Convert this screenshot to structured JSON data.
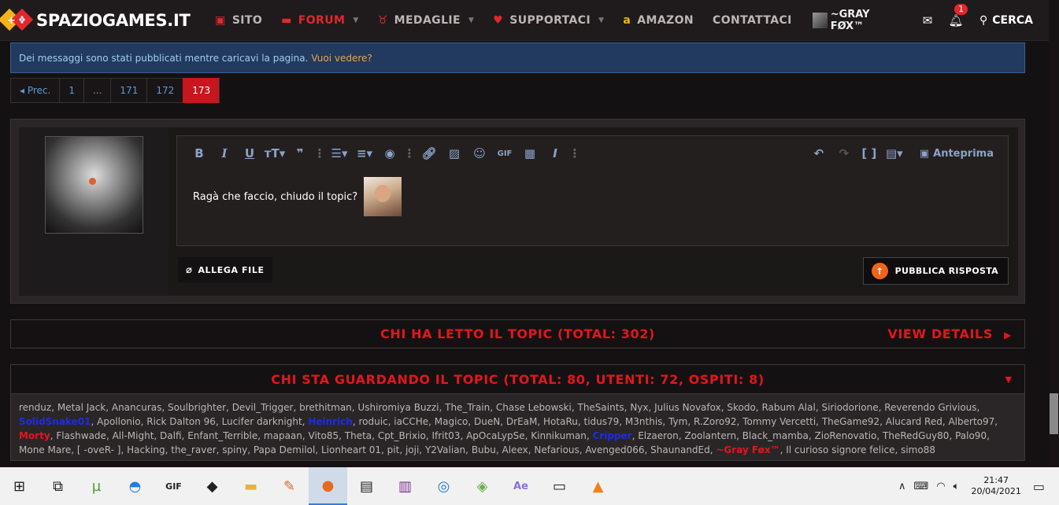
{
  "nav": {
    "logo": "SPAZIOGAMES.IT",
    "items": [
      {
        "label": "SITO",
        "icon": "gamepad-icon",
        "caret": false,
        "active": false
      },
      {
        "label": "FORUM",
        "icon": "chat-icon",
        "caret": true,
        "active": true
      },
      {
        "label": "MEDAGLIE",
        "icon": "medal-icon",
        "caret": true,
        "active": false
      },
      {
        "label": "SUPPORTACI",
        "icon": "heart-icon",
        "caret": true,
        "active": false
      },
      {
        "label": "AMAZON",
        "icon": "amazon-icon",
        "caret": false,
        "active": false
      },
      {
        "label": "CONTATTACI",
        "icon": "",
        "caret": false,
        "active": false
      }
    ],
    "user": "~GRAY FØX™",
    "notification_count": "1",
    "search": "CERCA"
  },
  "notice": {
    "text": "Dei messaggi sono stati pubblicati mentre caricavi la pagina.",
    "link": "Vuoi vedere?"
  },
  "pager": {
    "prev": "◂ Prec.",
    "pages": [
      "1",
      "...",
      "171",
      "172",
      "173"
    ],
    "current": "173"
  },
  "editor": {
    "content": "Ragà che faccio, chiudo il topic?",
    "preview": "Anteprima",
    "attach": "ALLEGA FILE",
    "publish": "PUBBLICA RISPOSTA"
  },
  "readers": {
    "title": "CHI HA LETTO IL TOPIC (TOTAL: 302)",
    "view_details": "VIEW DETAILS"
  },
  "watching": {
    "title": "CHI STA GUARDANDO IL TOPIC (TOTAL: 80, UTENTI: 72, OSPITI: 8)",
    "users": [
      {
        "n": "renduz"
      },
      {
        "n": "Metal Jack"
      },
      {
        "n": "Anancuras"
      },
      {
        "n": "Soulbrighter"
      },
      {
        "n": "Devil_Trigger"
      },
      {
        "n": "brethitman"
      },
      {
        "n": "Ushiromiya Buzzi"
      },
      {
        "n": "The_Train"
      },
      {
        "n": "Chase Lebowski"
      },
      {
        "n": "TheSaints"
      },
      {
        "n": "Nyx"
      },
      {
        "n": "Julius Novafox"
      },
      {
        "n": "Skodo"
      },
      {
        "n": "Rabum Alal"
      },
      {
        "n": "Siriodorione"
      },
      {
        "n": "Reverendo Grivious"
      },
      {
        "n": "SolidSnake01",
        "c": "blue"
      },
      {
        "n": "Apollonio"
      },
      {
        "n": "Rick Dalton 96"
      },
      {
        "n": "Lucifer darknight"
      },
      {
        "n": "Heinrich",
        "c": "blue"
      },
      {
        "n": "roduic"
      },
      {
        "n": "iaCCHe"
      },
      {
        "n": "Magico"
      },
      {
        "n": "DueN"
      },
      {
        "n": "DrEaM"
      },
      {
        "n": "HotaRu"
      },
      {
        "n": "tidus79"
      },
      {
        "n": "M3nthis"
      },
      {
        "n": "Tym"
      },
      {
        "n": "R.Zoro92"
      },
      {
        "n": "Tommy Vercetti"
      },
      {
        "n": "TheGame92"
      },
      {
        "n": "Alucard Red"
      },
      {
        "n": "Alberto97"
      },
      {
        "n": "Morty",
        "c": "red"
      },
      {
        "n": "Flashwade"
      },
      {
        "n": "All-Might"
      },
      {
        "n": "Dalfi"
      },
      {
        "n": "Enfant_Terrible"
      },
      {
        "n": "mapaan"
      },
      {
        "n": "Vito85"
      },
      {
        "n": "Theta"
      },
      {
        "n": "Cpt_Brixio"
      },
      {
        "n": "Ifrit03"
      },
      {
        "n": "ApOcaLypSe"
      },
      {
        "n": "Kinnikuman"
      },
      {
        "n": "Cripper",
        "c": "blue"
      },
      {
        "n": "Elzaeron"
      },
      {
        "n": "Zoolantern"
      },
      {
        "n": "Black_mamba"
      },
      {
        "n": "ZioRenovatio"
      },
      {
        "n": "TheRedGuy80"
      },
      {
        "n": "Palo90"
      },
      {
        "n": "Mone Mare"
      },
      {
        "n": "[ -oveR- ]"
      },
      {
        "n": "Hacking"
      },
      {
        "n": "the_raver"
      },
      {
        "n": "spiny"
      },
      {
        "n": "Papa Demilol"
      },
      {
        "n": "Lionheart 01"
      },
      {
        "n": "pit"
      },
      {
        "n": "joji"
      },
      {
        "n": "Y2Valian"
      },
      {
        "n": "Bubu"
      },
      {
        "n": "Aleex"
      },
      {
        "n": "Nefarious"
      },
      {
        "n": "Avenged066"
      },
      {
        "n": "ShaunandEd"
      },
      {
        "n": "~Gray Føx™",
        "c": "red"
      },
      {
        "n": "Il curioso signore felice"
      },
      {
        "n": "simo88"
      }
    ]
  },
  "taskbar": {
    "apps": [
      "windows-start-icon",
      "task-view-icon",
      "utorrent-icon",
      "edge-icon",
      "gif-app-icon",
      "game-icon",
      "file-explorer-icon",
      "paint-icon",
      "firefox-icon",
      "media-icon",
      "winrar-icon",
      "instagram-icon",
      "bluestacks-icon",
      "after-effects-icon",
      "slideshow-icon",
      "vlc-icon"
    ],
    "time": "21:47",
    "date": "20/04/2021"
  }
}
